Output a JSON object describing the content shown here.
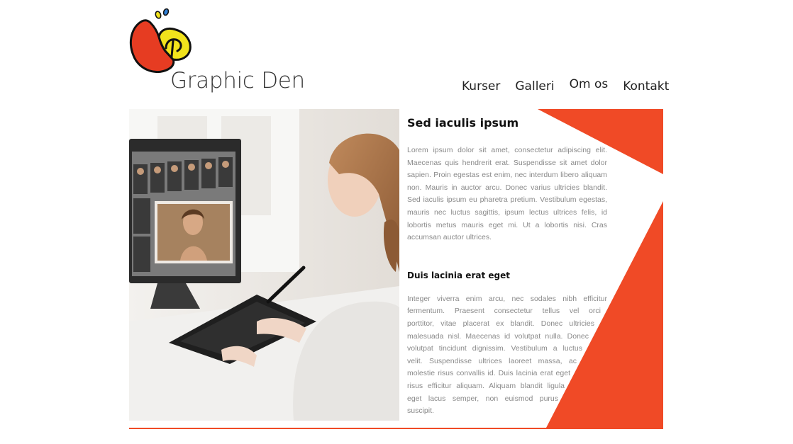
{
  "brand": {
    "name": "Graphic Den"
  },
  "nav": {
    "items": [
      "Kurser",
      "Galleri",
      "Om os",
      "Kontakt"
    ]
  },
  "article": {
    "heading": "Sed iaculis ipsum",
    "paragraph1": "Lorem ipsum dolor sit amet, consectetur adipiscing elit. Maecenas quis hendrerit erat. Suspendisse sit amet dolor sapien. Proin egestas est enim, nec interdum libero aliquam non. Mauris in auctor arcu. Donec varius ultricies blandit. Sed iaculis ipsum eu pharetra pretium. Vestibulum egestas, mauris nec luctus sagittis, ipsum lectus ultrices felis, id lobortis metus mauris eget mi. Ut a lobortis nisi. Cras accumsan auctor ultrices.",
    "subheading": "Duis lacinia erat eget",
    "paragraph2_lines": [
      "Integer viverra enim arcu, nec sodales nibh efficitur",
      "fermentum. Praesent consectetur tellus vel orci",
      "porttitor, vitae placerat ex blandit. Donec ultricies",
      "malesuada nisl. Maecenas id volutpat nulla. Donec",
      "volutpat tincidunt dignissim. Vestibulum a luctus",
      "velit. Suspendisse ultrices laoreet massa, ac",
      "molestie risus convallis id. Duis lacinia erat eget",
      "risus efficitur aliquam. Aliquam blandit ligula",
      "eget lacus semper, non euismod purus",
      "suscipit."
    ]
  },
  "colors": {
    "accent": "#f04a26",
    "logo_red": "#e63c22",
    "logo_yellow": "#f2e31c",
    "logo_blue": "#2f7fd6"
  }
}
